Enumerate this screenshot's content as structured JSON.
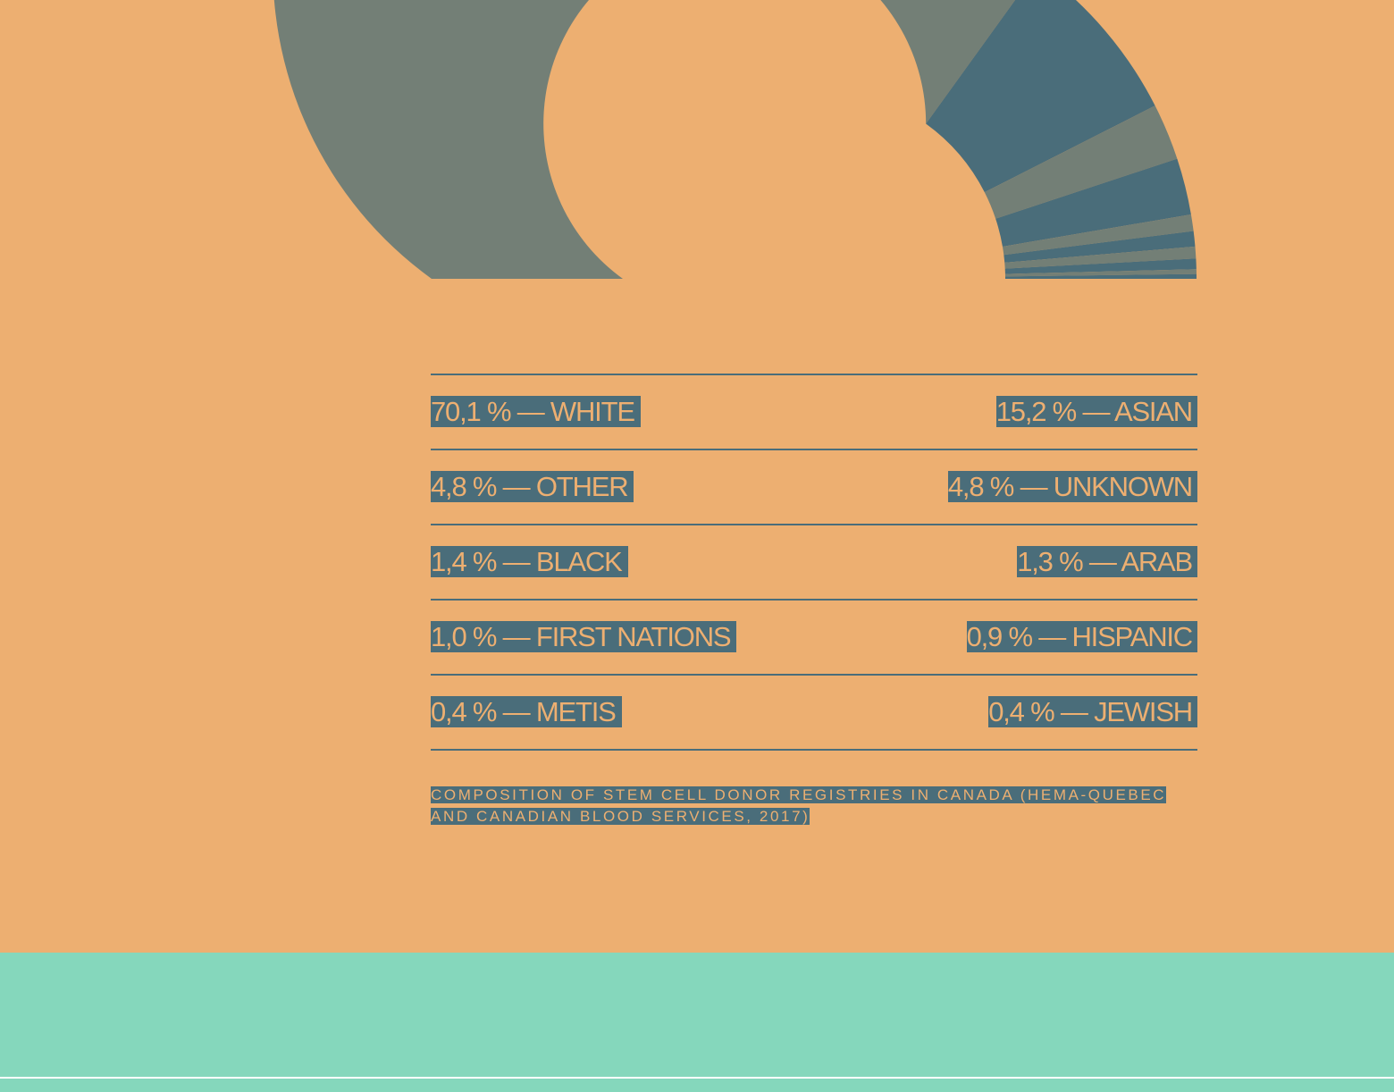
{
  "chart_data": {
    "type": "pie",
    "variant": "half-donut",
    "categories": [
      "WHITE",
      "ASIAN",
      "OTHER",
      "UNKNOWN",
      "BLACK",
      "ARAB",
      "FIRST NATIONS",
      "HISPANIC",
      "METIS",
      "JEWISH"
    ],
    "values": [
      70.1,
      15.2,
      4.8,
      4.8,
      1.4,
      1.3,
      1.0,
      0.9,
      0.4,
      0.4
    ],
    "slice_colors": [
      "#737f76",
      "#4a6d7a",
      "#737f76",
      "#4a6d7a",
      "#737f76",
      "#4a6d7a",
      "#737f76",
      "#4a6d7a",
      "#737f76",
      "#4a6d7a"
    ],
    "legend": {
      "rows": [
        {
          "left": "70,1 % — WHITE",
          "right": "15,2 % — ASIAN"
        },
        {
          "left": "4,8 % — OTHER",
          "right": "4,8 % — UNKNOWN"
        },
        {
          "left": "1,4 % — BLACK",
          "right": "1,3 % — ARAB"
        },
        {
          "left": "1,0 % — FIRST NATIONS",
          "right": "0,9 % — HISPANIC"
        },
        {
          "left": "0,4 % — METIS",
          "right": "0,4 % — JEWISH"
        }
      ]
    },
    "caption": "COMPOSITION OF STEM CELL DONOR REGISTRIES IN CANADA (HEMA-QUEBEC AND CANADIAN BLOOD SERVICES, 2017)"
  },
  "colors": {
    "background": "#edaf71",
    "highlight": "#4a6d7a",
    "footer_band": "#85d7bc",
    "footer_line": "#ffffff"
  }
}
